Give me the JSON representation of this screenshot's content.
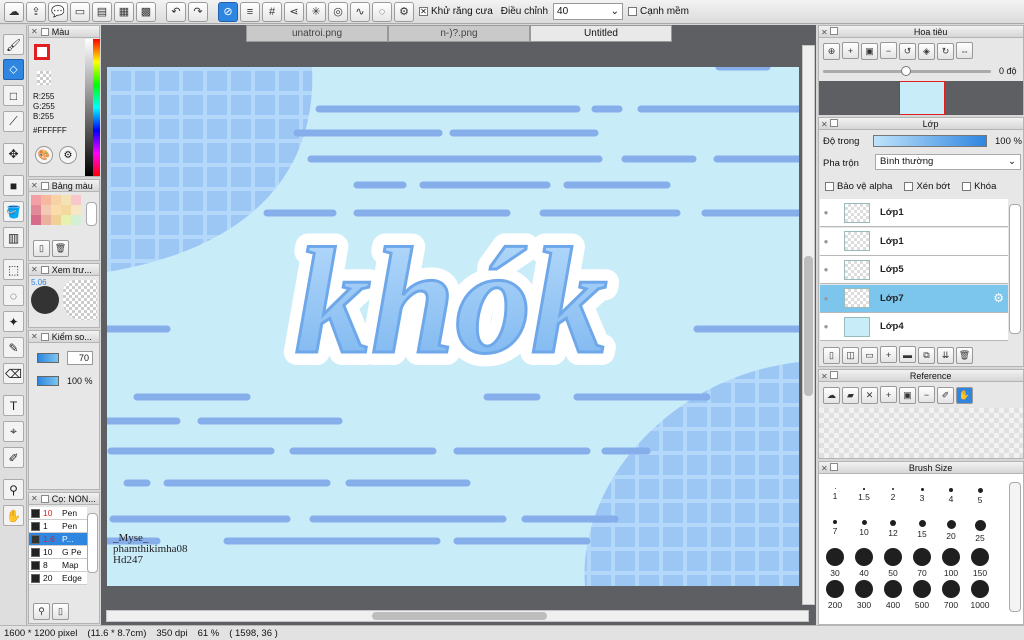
{
  "toolbar": {
    "antialias_label": "Khử răng cưa",
    "adjust_label": "Điều chỉnh",
    "adjust_value": "40",
    "soft_edge_label": "Cạnh mềm"
  },
  "color_panel": {
    "title": "Màu",
    "rgb_r": "R:255",
    "rgb_g": "G:255",
    "rgb_b": "B:255",
    "hex": "#FFFFFF"
  },
  "swatch_panel": {
    "title": "Bảng màu"
  },
  "preview_panel": {
    "title": "Xem trư...",
    "value": "5.06"
  },
  "control_panel": {
    "title": "Kiểm so...",
    "size_value": "70",
    "opacity_value": "100 %"
  },
  "brush_list": {
    "title": "Cọ: NON...",
    "items": [
      {
        "size": "10",
        "name": "Pen",
        "color": "#e02020"
      },
      {
        "size": "1",
        "name": "Pen",
        "color": "#111111"
      },
      {
        "size": "1.6",
        "name": "P...",
        "color": "#e02020"
      },
      {
        "size": "10",
        "name": "G Pe",
        "color": "#111111"
      },
      {
        "size": "8",
        "name": "Map",
        "color": "#111111"
      },
      {
        "size": "20",
        "name": "Edge",
        "color": "#111111"
      }
    ]
  },
  "tabs": [
    {
      "label": "unatroi.png"
    },
    {
      "label": "n-)?.png"
    },
    {
      "label": "Untitled"
    }
  ],
  "artwork": {
    "title_text": "khók",
    "signature_line1": "_Myse_",
    "signature_line2": "phamthikimha08",
    "signature_line3": "Hd247"
  },
  "navigator": {
    "title": "Hoa tiêu",
    "angle": "0 độ"
  },
  "layer_panel": {
    "title": "Lớp",
    "opacity_label": "Độ trong",
    "opacity_value": "100 %",
    "blend_label": "Pha trộn",
    "blend_value": "Bình thường",
    "protect_alpha": "Bảo vệ alpha",
    "clip": "Xén bớt",
    "lock": "Khóa",
    "layers": [
      {
        "name": "Lớp1",
        "selected": false
      },
      {
        "name": "Lớp1",
        "selected": false
      },
      {
        "name": "Lớp5",
        "selected": false
      },
      {
        "name": "Lớp7",
        "selected": true
      },
      {
        "name": "Lớp4",
        "selected": false
      }
    ]
  },
  "reference_panel": {
    "title": "Reference"
  },
  "brush_size_panel": {
    "title": "Brush Size",
    "sizes": [
      "1",
      "1.5",
      "2",
      "3",
      "4",
      "5",
      "7",
      "10",
      "12",
      "15",
      "20",
      "25",
      "30",
      "40",
      "50",
      "70",
      "100",
      "150",
      "200",
      "300",
      "400",
      "500",
      "700",
      "1000"
    ]
  },
  "status": {
    "pixels": "1600 * 1200 pixel",
    "cm": "(11.6 * 8.7cm)",
    "dpi": "350 dpi",
    "zoom": "61 %",
    "coords": "( 1598, 36 )"
  },
  "colors": {
    "accent": "#2f86e0",
    "canvas_bg": "#c9ecf9",
    "grid_blue": "#99c5f4",
    "dash_blue": "#86aeea",
    "layer_selected": "#7cc6ee"
  }
}
